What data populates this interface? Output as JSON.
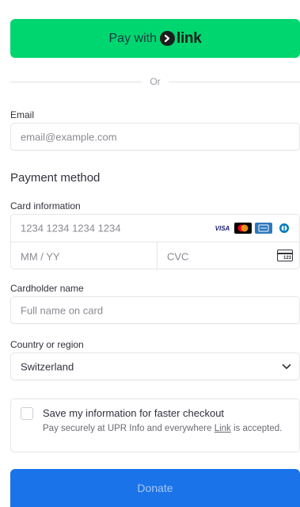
{
  "link_button": {
    "pay_text": "Pay with",
    "link_word": "link",
    "color": "#00d66f"
  },
  "divider": {
    "text": "Or"
  },
  "email": {
    "label": "Email",
    "placeholder": "email@example.com"
  },
  "payment_method": {
    "title": "Payment method"
  },
  "card": {
    "label": "Card information",
    "number_placeholder": "1234 1234 1234 1234",
    "expiry_placeholder": "MM / YY",
    "cvc_placeholder": "CVC",
    "brands": [
      "visa",
      "mastercard",
      "amex",
      "diners"
    ],
    "brand_visa_text": "VISA",
    "cvc_icon_text": "123"
  },
  "cardholder": {
    "label": "Cardholder name",
    "placeholder": "Full name on card"
  },
  "country": {
    "label": "Country or region",
    "value": "Switzerland"
  },
  "save": {
    "title": "Save my information for faster checkout",
    "desc_before": "Pay securely at UPR Info and everywhere ",
    "desc_link": "Link",
    "desc_after": " is accepted.",
    "checked": false
  },
  "donate_button": {
    "label": "Donate",
    "color": "#1a73e8"
  }
}
